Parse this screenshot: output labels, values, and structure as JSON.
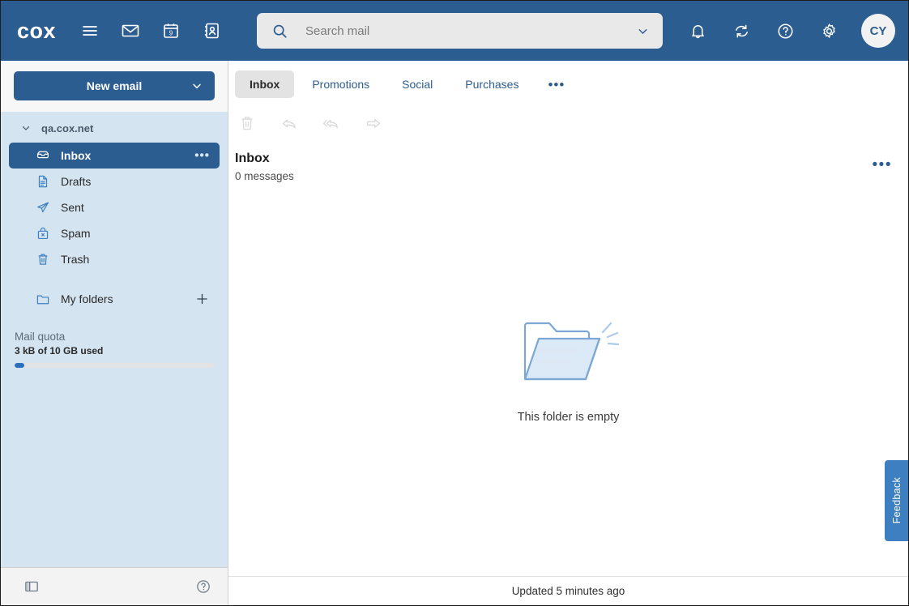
{
  "header": {
    "logo": "cox",
    "icons": [
      {
        "name": "hamburger-menu-icon",
        "label": "Menu"
      },
      {
        "name": "mail-icon",
        "label": "Mail"
      },
      {
        "name": "calendar-icon",
        "label": "Calendar",
        "day": "9"
      },
      {
        "name": "contacts-icon",
        "label": "Contacts"
      }
    ],
    "search": {
      "placeholder": "Search mail",
      "value": "",
      "search_icon": "search-icon",
      "chevron_icon": "chevron-down-icon"
    },
    "right_icons": [
      {
        "name": "notifications-bell-icon",
        "label": "Notifications"
      },
      {
        "name": "refresh-icon",
        "label": "Refresh"
      },
      {
        "name": "help-circle-icon",
        "label": "Help"
      },
      {
        "name": "settings-gear-icon",
        "label": "Settings"
      }
    ],
    "avatar": "CY"
  },
  "sidebar": {
    "new_email_label": "New email",
    "new_email_chevron": "chevron-down-icon",
    "account": {
      "name": "qa.cox.net",
      "chevron": "chevron-down-icon"
    },
    "folders": [
      {
        "label": "Inbox",
        "icon": "inbox-icon",
        "active": true,
        "menu": "more-options-icon"
      },
      {
        "label": "Drafts",
        "icon": "drafts-document-icon",
        "active": false
      },
      {
        "label": "Sent",
        "icon": "sent-paper-plane-icon",
        "active": false
      },
      {
        "label": "Spam",
        "icon": "spam-bag-icon",
        "active": false
      },
      {
        "label": "Trash",
        "icon": "trash-bin-icon",
        "active": false
      }
    ],
    "my_folders": {
      "label": "My folders",
      "icon": "folder-icon",
      "add_icon": "plus-icon"
    },
    "quota": {
      "title": "Mail quota",
      "detail": "3 kB of 10 GB used",
      "percent": 5
    },
    "bottom": {
      "toggle_pane_icon": "toggle-sidebar-icon",
      "help_icon": "help-circle-icon"
    }
  },
  "main": {
    "tabs": [
      {
        "label": "Inbox",
        "active": true
      },
      {
        "label": "Promotions",
        "active": false
      },
      {
        "label": "Social",
        "active": false
      },
      {
        "label": "Purchases",
        "active": false
      }
    ],
    "tabs_more": "•••",
    "toolbar": [
      {
        "name": "delete-icon",
        "label": "Delete",
        "disabled": true
      },
      {
        "name": "reply-icon",
        "label": "Reply",
        "disabled": true
      },
      {
        "name": "reply-all-icon",
        "label": "Reply all",
        "disabled": true
      },
      {
        "name": "forward-icon",
        "label": "Forward",
        "disabled": true
      }
    ],
    "list_header": {
      "title": "Inbox",
      "count": "0 messages",
      "more": "•••"
    },
    "empty_state": {
      "illustration": "empty-folder-illustration",
      "message": "This folder is empty"
    },
    "status": "Updated 5 minutes ago"
  },
  "feedback": {
    "label": "Feedback"
  },
  "colors": {
    "brand_blue": "#2c5d90",
    "sidebar_bg": "#d4e4f0",
    "accent_blue": "#3d7fc1",
    "quota_fill": "#2c6fbf"
  }
}
